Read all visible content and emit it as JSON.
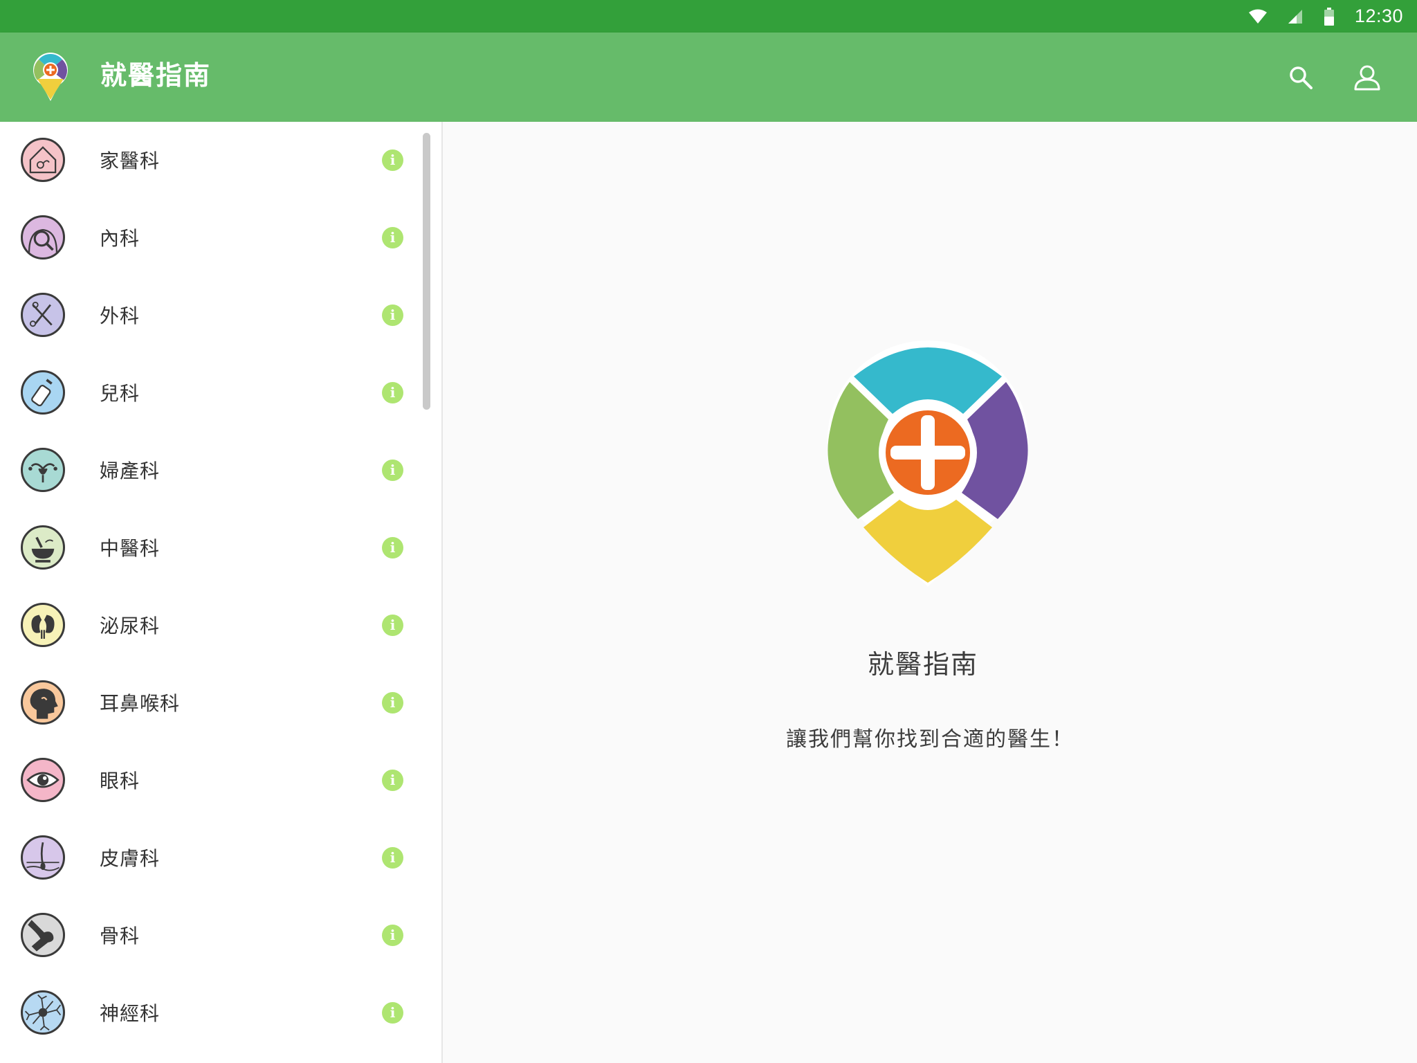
{
  "status_bar": {
    "time": "12:30",
    "icons": [
      "wifi-icon",
      "cell-signal-icon",
      "battery-icon"
    ],
    "color": "#33a03a"
  },
  "app_bar": {
    "title": "就醫指南",
    "color": "#66bb6a",
    "actions": [
      "search-icon",
      "account-icon"
    ]
  },
  "sidebar": {
    "info_glyph": "i",
    "departments": [
      {
        "label": "家醫科",
        "icon": "house-doctor-icon",
        "color": "#f5c3c8"
      },
      {
        "label": "內科",
        "icon": "body-magnifier-icon",
        "color": "#dcb8e0"
      },
      {
        "label": "外科",
        "icon": "scissors-scalpel-icon",
        "color": "#c7c3e8"
      },
      {
        "label": "兒科",
        "icon": "baby-bottle-icon",
        "color": "#a9d6f2"
      },
      {
        "label": "婦產科",
        "icon": "uterus-icon",
        "color": "#a8dad4"
      },
      {
        "label": "中醫科",
        "icon": "herb-mortar-icon",
        "color": "#dcebc7"
      },
      {
        "label": "泌尿科",
        "icon": "kidney-icon",
        "color": "#f7f2b8"
      },
      {
        "label": "耳鼻喉科",
        "icon": "head-profile-icon",
        "color": "#f9c89c"
      },
      {
        "label": "眼科",
        "icon": "eye-icon",
        "color": "#f4b6c8"
      },
      {
        "label": "皮膚科",
        "icon": "skin-hair-icon",
        "color": "#d7c7ea"
      },
      {
        "label": "骨科",
        "icon": "knee-bone-icon",
        "color": "#d9d9d9"
      },
      {
        "label": "神經科",
        "icon": "neuron-icon",
        "color": "#b7d9f2"
      }
    ]
  },
  "main": {
    "title": "就醫指南",
    "subtitle": "讓我們幫你找到合適的醫生！",
    "logo": "map-pin-medical-logo",
    "logo_colors": {
      "top": "#35b9cc",
      "left": "#93c05f",
      "right": "#7052a0",
      "bottom": "#f0cf3d",
      "center": "#ec6a21"
    }
  }
}
